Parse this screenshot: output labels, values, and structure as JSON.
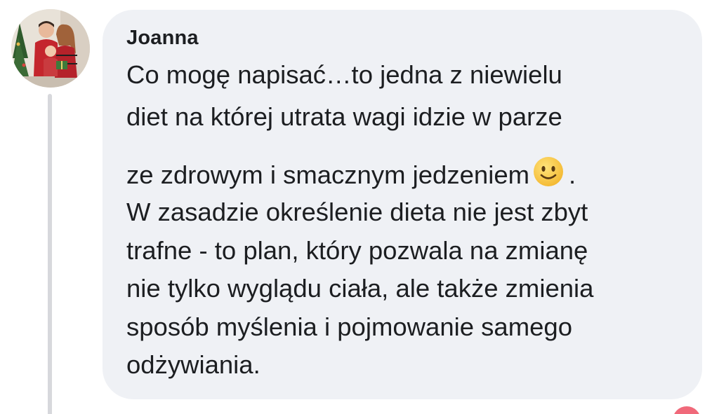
{
  "comment": {
    "author": "Joanna",
    "lines": [
      "Co mogę napisać…to jedna z niewielu",
      "diet na której utrata wagi idzie w parze",
      "ze zdrowym i smacznym jedzeniem",
      "W zasadzie określenie dieta nie jest zbyt",
      "trafne - to plan, który pozwala na zmianę",
      "nie tylko wyglądu ciała, ale także zmienia",
      "sposób myślenia i pojmowanie samego",
      "odżywiania."
    ],
    "line3_suffix": ".",
    "emoji": "slightly-smiling-face-icon"
  },
  "colors": {
    "bubble": "#eff1f5",
    "text": "#1c1e21",
    "thread_line": "#d7d8dc",
    "reaction": "#f0697a"
  }
}
